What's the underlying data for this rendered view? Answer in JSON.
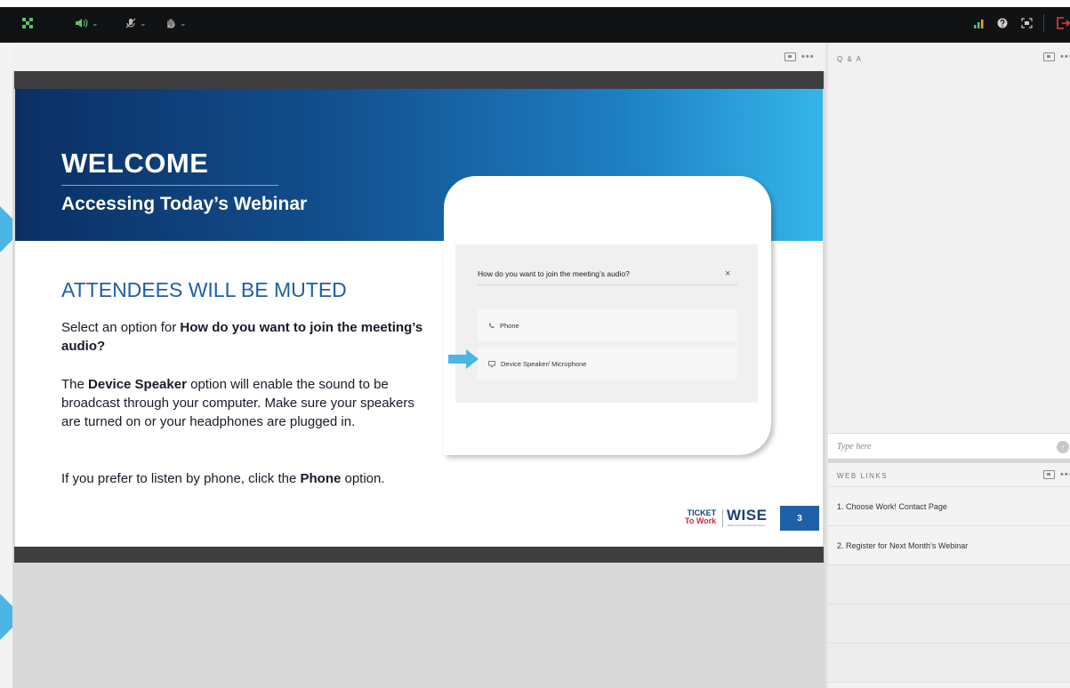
{
  "colors": {
    "toolbar_bg": "#111214",
    "slide_banner_start": "#0b2f64",
    "slide_banner_end": "#35b5ea",
    "accent_blue": "#1f5fa8",
    "arrow_blue": "#4db4e6",
    "leave_red": "#e0403a",
    "connection_green": "#5cc26a"
  },
  "toolbar": {
    "icons": [
      "layout-grid-icon",
      "speaker-icon",
      "microphone-icon",
      "raise-hand-icon",
      "connection-bars-icon",
      "help-icon",
      "fullscreen-icon",
      "leave-icon"
    ],
    "chevron": "⌄"
  },
  "share_pod": {
    "controls": {
      "more": "•••"
    }
  },
  "slide": {
    "welcome": "WELCOME",
    "subtitle": "Accessing Today’s Webinar",
    "muted_heading": "ATTENDEES WILL BE MUTED",
    "para1": {
      "a": "Select an option for ",
      "b": "How do you want to join the meeting’s audio?"
    },
    "para2": {
      "a": "The ",
      "b": "Device Speaker",
      "c": " option will enable the sound to be broadcast through your computer. Make sure your speakers are turned on or your headphones are plugged in."
    },
    "para3": {
      "a": "If you prefer to listen by phone, click the ",
      "b": "Phone",
      "c": " option."
    },
    "dialog": {
      "title": "How do you want to join the meeting’s audio?",
      "close": "×",
      "option_phone": "Phone",
      "option_device": "Device Speaker/ Microphone"
    },
    "logo": {
      "ticket": "TICKET",
      "to_work": "To Work",
      "wise": "WISE",
      "wise_sub": "Work Incentives Seminar Event"
    },
    "page_number": "3"
  },
  "qa_pod": {
    "title": "Q & A",
    "more": "•••",
    "input_placeholder": "Type here",
    "send_symbol": "↑"
  },
  "web_links_pod": {
    "title": "WEB LINKS",
    "more": "•••",
    "links": [
      "1. Choose Work! Contact Page",
      "2. Register for Next Month’s Webinar"
    ]
  }
}
